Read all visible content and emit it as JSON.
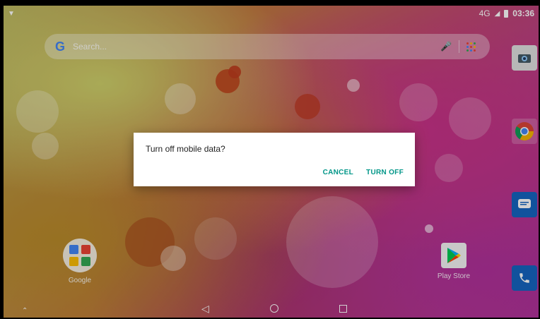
{
  "status_bar": {
    "network_label": "4G",
    "time": "03:36",
    "wifi_icon": "wifi-icon",
    "signal_icon": "signal-icon",
    "battery_icon": "battery-icon"
  },
  "search": {
    "placeholder": "Search...",
    "google_icon": "google-g-icon",
    "mic_icon": "mic-icon",
    "apps_icon": "app-grid-icon"
  },
  "dock": {
    "items": [
      {
        "name": "camera",
        "icon": "camera-icon"
      },
      {
        "name": "chrome",
        "icon": "chrome-icon"
      },
      {
        "name": "messages",
        "icon": "messages-icon"
      },
      {
        "name": "phone",
        "icon": "phone-icon"
      }
    ]
  },
  "home_apps": [
    {
      "label": "Google",
      "icon": "google-folder-icon"
    },
    {
      "label": "Play Store",
      "icon": "play-store-icon"
    }
  ],
  "nav": {
    "back_icon": "back-icon",
    "home_icon": "home-icon",
    "recents_icon": "recents-icon",
    "up_icon": "chevron-up-icon"
  },
  "dialog": {
    "title": "Turn off mobile data?",
    "cancel_label": "CANCEL",
    "confirm_label": "TURN OFF"
  },
  "colors": {
    "accent": "#009688",
    "dock_blue": "#1565c0"
  }
}
